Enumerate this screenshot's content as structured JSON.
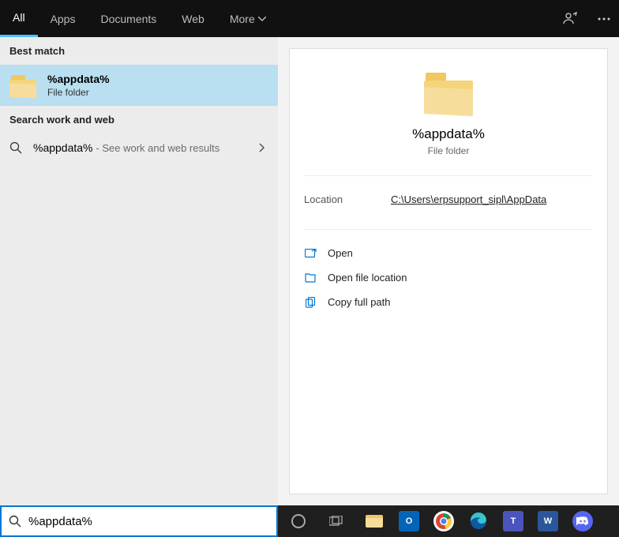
{
  "tabs": {
    "all": "All",
    "apps": "Apps",
    "documents": "Documents",
    "web": "Web",
    "more": "More"
  },
  "left": {
    "best_match_label": "Best match",
    "result": {
      "name": "%appdata%",
      "type": "File folder"
    },
    "sww_label": "Search work and web",
    "web_row": {
      "term": "%appdata%",
      "hint": "- See work and web results"
    }
  },
  "preview": {
    "title": "%appdata%",
    "subtitle": "File folder",
    "location_label": "Location",
    "location_value": "C:\\Users\\erpsupport_sipl\\AppData",
    "actions": {
      "open": "Open",
      "open_loc": "Open file location",
      "copy_path": "Copy full path"
    }
  },
  "search": {
    "value": "%appdata%"
  },
  "taskbar_apps": [
    {
      "name": "file-explorer",
      "bg": "#1f1f1f",
      "inner": "fe"
    },
    {
      "name": "outlook",
      "bg": "#0364b8",
      "text": "O"
    },
    {
      "name": "chrome",
      "bg": "#fff",
      "inner": "chrome"
    },
    {
      "name": "edge",
      "bg": "#1f1f1f",
      "inner": "edge"
    },
    {
      "name": "teams",
      "bg": "#4b53bc",
      "text": "T"
    },
    {
      "name": "word",
      "bg": "#2b579a",
      "text": "W"
    },
    {
      "name": "discord",
      "bg": "#5865f2",
      "inner": "discord"
    }
  ]
}
